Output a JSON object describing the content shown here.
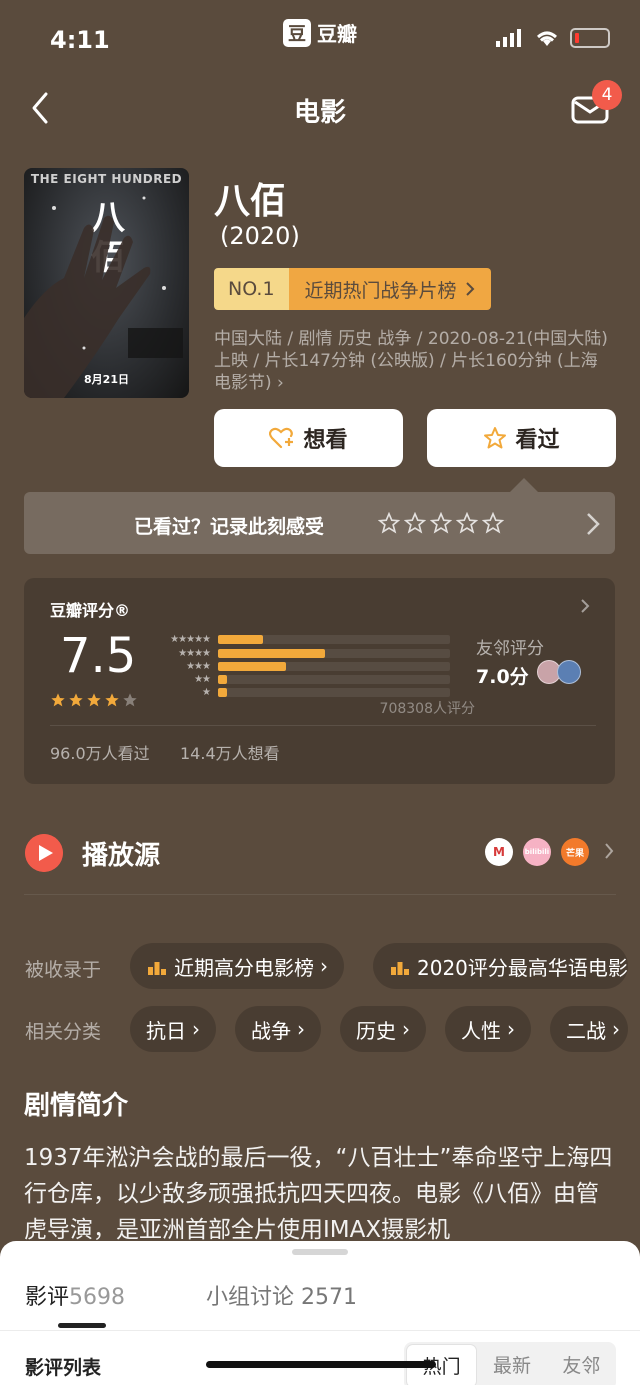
{
  "status": {
    "time": "4:11",
    "app_logo_char": "豆",
    "app_name": "豆瓣"
  },
  "nav": {
    "title": "电影",
    "mail_badge": "4"
  },
  "poster": {
    "top_text": "THE EIGHT HUNDRED",
    "char1": "八",
    "char2": "佰",
    "date_text": "8月21日"
  },
  "movie": {
    "title": "八佰",
    "year": "(2020)",
    "rank_no": "NO.1",
    "rank_name": "近期热门战争片榜",
    "meta": "中国大陆 / 剧情 历史 战争 / 2020-08-21(中国大陆) 上映 / 片长147分钟 (公映版) / 片长160分钟 (上海电影节)"
  },
  "actions": {
    "want_label": "想看",
    "seen_label": "看过"
  },
  "seen_prompt": "已看过？记录此刻感受",
  "rating": {
    "label": "豆瓣评分®",
    "score": "7.5",
    "stars": 4,
    "distribution": [
      {
        "stars": "★★★★★",
        "percent": 19.5
      },
      {
        "stars": "★★★★",
        "percent": 46
      },
      {
        "stars": "★★★",
        "percent": 29.5
      },
      {
        "stars": "★★",
        "percent": 4
      },
      {
        "stars": "★",
        "percent": 4
      }
    ],
    "count": "708308人评分",
    "friend_label": "友邻评分",
    "friend_score": "7.0分",
    "seen_count": "96.0万人看过",
    "want_count": "14.4万人想看"
  },
  "play": {
    "label": "播放源",
    "sources": [
      "M",
      "bilibili",
      "芒果"
    ]
  },
  "collections": {
    "label": "被收录于",
    "items": [
      "近期高分电影榜",
      "2020评分最高华语电影"
    ]
  },
  "categories": {
    "label": "相关分类",
    "items": [
      "抗日",
      "战争",
      "历史",
      "人性",
      "二战"
    ]
  },
  "synopsis": {
    "title": "剧情简介",
    "text": "1937年淞沪会战的最后一役，“八百壮士”奉命坚守上海四行仓库，以少敌多顽强抵抗四天四夜。电影《八佰》由管虎导演，是亚洲首部全片使用IMAX摄影机"
  },
  "sheet": {
    "tab_reviews": "影评",
    "tab_reviews_count": "5698",
    "tab_groups": "小组讨论 2571",
    "list_title": "影评列表",
    "sort_hot": "热门",
    "sort_new": "最新",
    "sort_friends": "友邻"
  },
  "colors": {
    "background": "#5a4b3d",
    "accent": "#f2a93b",
    "red": "#f25b4b"
  }
}
